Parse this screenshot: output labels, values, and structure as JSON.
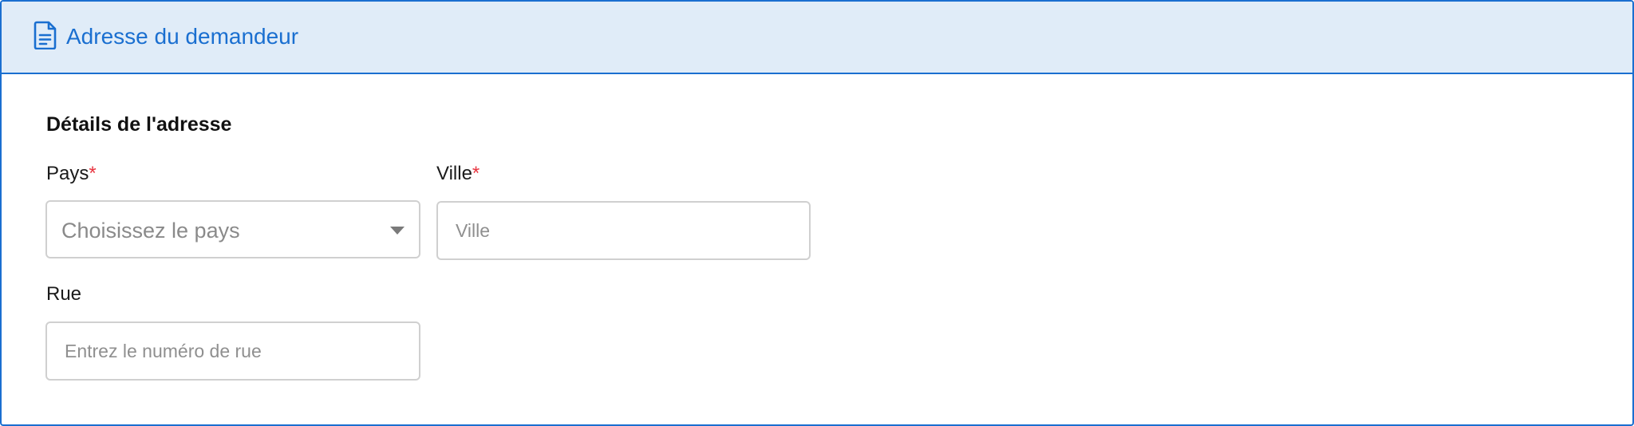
{
  "header": {
    "title": "Adresse du demandeur",
    "icon": "document-icon"
  },
  "colors": {
    "accent": "#1a6fd0",
    "header_bg": "#e0ecf8",
    "required": "#e8343f",
    "input_border": "#d0d0d0",
    "placeholder": "#8f8f8f"
  },
  "section": {
    "title": "Détails de l'adresse"
  },
  "fields": {
    "pays": {
      "label": "Pays",
      "required_mark": "*",
      "placeholder": "Choisissez le pays",
      "icon": "caret-down-icon"
    },
    "ville": {
      "label": "Ville",
      "required_mark": "*",
      "placeholder": "Ville",
      "value": ""
    },
    "rue": {
      "label": "Rue",
      "placeholder": "Entrez le numéro de rue",
      "value": ""
    }
  }
}
